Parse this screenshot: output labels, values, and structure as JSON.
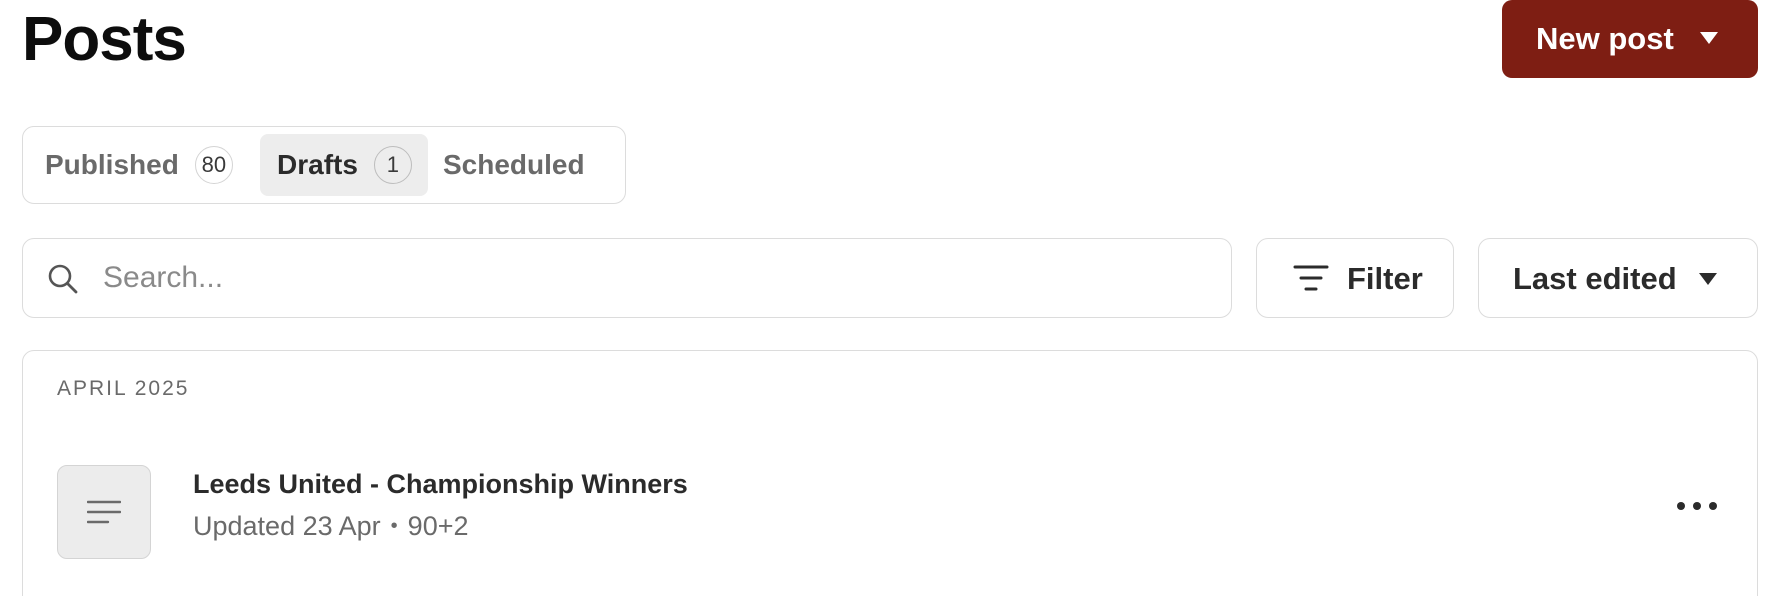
{
  "header": {
    "title": "Posts",
    "new_post_label": "New post",
    "accent_color": "#7e1e13"
  },
  "tabs": [
    {
      "label": "Published",
      "count": "80",
      "active": false
    },
    {
      "label": "Drafts",
      "count": "1",
      "active": true
    },
    {
      "label": "Scheduled",
      "active": false
    }
  ],
  "toolbar": {
    "search_placeholder": "Search...",
    "search_value": "",
    "filter_label": "Filter",
    "sort_label": "Last edited"
  },
  "list": {
    "group_label": "APRIL 2025",
    "posts": [
      {
        "title": "Leeds United - Championship Winners",
        "updated": "Updated 23 Apr",
        "separator": "•",
        "extra": "90+2"
      }
    ]
  },
  "icons": {
    "search": "search-icon",
    "filter": "filter-lines-icon",
    "caret": "caret-down-icon",
    "post": "text-lines-icon",
    "more": "more-horizontal-icon"
  }
}
